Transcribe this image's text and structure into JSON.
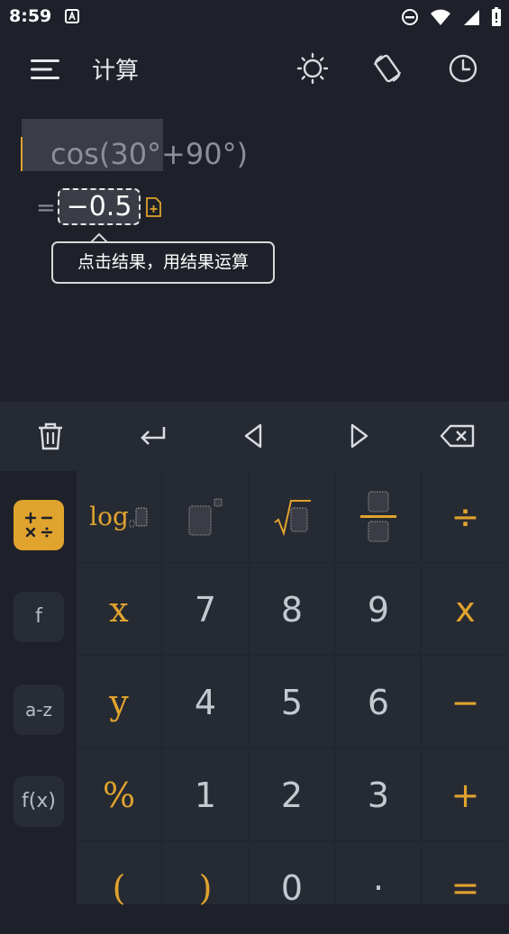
{
  "status": {
    "time": "8:59"
  },
  "app": {
    "title": "计算"
  },
  "display": {
    "expression": "cos(30°+90°)",
    "equals": "=",
    "result": "−0.5",
    "tooltip": "点击结果，用结果运算"
  },
  "sidebar": {
    "items": [
      {
        "label": "",
        "icon": "arithmetic-operators-icon",
        "active": true
      },
      {
        "label": "f",
        "active": false
      },
      {
        "label": "a-z",
        "active": false
      },
      {
        "label": "f(x)",
        "active": false
      }
    ]
  },
  "keys": {
    "row1": {
      "log": "log",
      "div": "÷"
    },
    "row2": [
      "x",
      "7",
      "8",
      "9",
      "x"
    ],
    "row3": [
      "y",
      "4",
      "5",
      "6",
      "−"
    ],
    "row4": [
      "%",
      "1",
      "2",
      "3",
      "+"
    ],
    "row5": [
      "(",
      ")",
      "0",
      "·",
      "="
    ]
  },
  "colors": {
    "accent": "#e0a32e",
    "background": "#1e2129",
    "keypad": "#262a33"
  }
}
